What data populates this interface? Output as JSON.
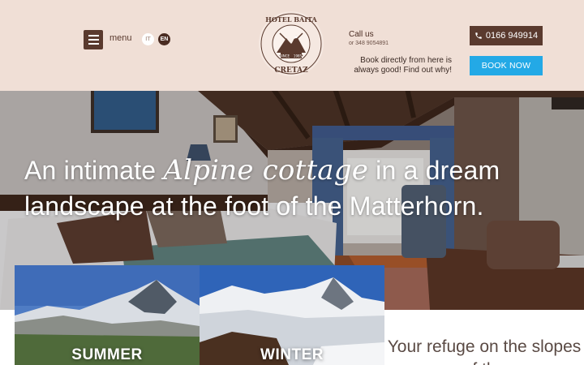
{
  "header": {
    "menu_label": "menu",
    "languages": [
      "IT",
      "EN"
    ],
    "logo": {
      "name_top": "HOTEL BAITA",
      "name_bottom": "CRETAZ",
      "since_label": "SINCE",
      "since_year": "1985"
    },
    "call": {
      "title": "Call us",
      "secondary": "or 348 9054891"
    },
    "phone_button": "0166 949914",
    "book_note": "Book directly from here is always good! Find out why!",
    "book_button": "BOOK NOW"
  },
  "hero": {
    "headline_part1": "An intimate ",
    "headline_script": "Alpine cottage",
    "headline_part2": " in a dream landscape at the foot of the Matterhorn."
  },
  "tiles": {
    "summer": "SUMMER",
    "winter": "WINTER"
  },
  "refuge": {
    "title": "Your refuge on the slopes of the"
  },
  "colors": {
    "header_bg": "#f0dfd6",
    "band": "#c9a293",
    "brown": "#5a3a2e",
    "accent_blue": "#23a9e6"
  }
}
